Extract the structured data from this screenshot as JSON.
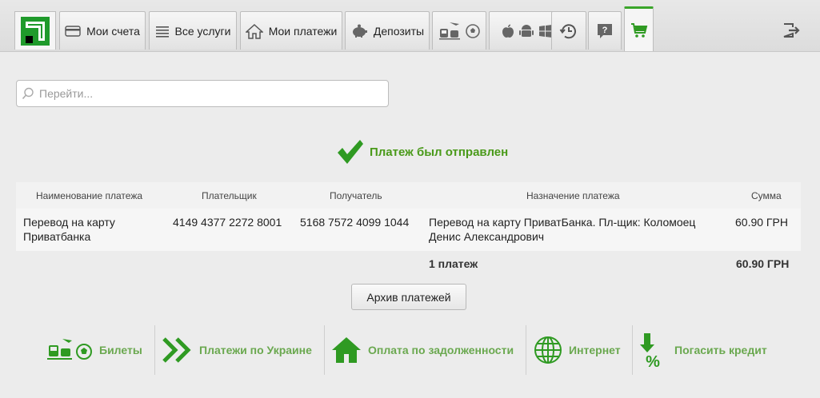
{
  "nav": {
    "tabs": [
      {
        "label": "Мои счета",
        "icon": "card-icon"
      },
      {
        "label": "Все услуги",
        "icon": "list-icon"
      },
      {
        "label": "Мои платежи",
        "icon": "home-icon"
      },
      {
        "label": "Депозиты",
        "icon": "piggy-bank-icon"
      }
    ]
  },
  "search": {
    "placeholder": "Перейти..."
  },
  "status": {
    "message": "Платеж был отправлен"
  },
  "table": {
    "headers": [
      "Наименование платежа",
      "Плательщик",
      "Получатель",
      "Назначение платежа",
      "Сумма"
    ],
    "rows": [
      {
        "name_line1": "Перевод на карту",
        "name_line2": "Приватбанка",
        "payer": "4149 4377 2272 8001",
        "recipient": "5168 7572 4099 1044",
        "purpose_line1": "Перевод на карту ПриватБанка. Пл-щик: Коломоец",
        "purpose_line2": "Денис Александрович",
        "amount": "60.90 ГРН"
      }
    ],
    "total": {
      "count": "1 платеж",
      "amount": "60.90 ГРН"
    }
  },
  "archive_button": "Архив платежей",
  "shortcuts": [
    {
      "label": "Билеты",
      "icon": "tickets-icon"
    },
    {
      "label": "Платежи по Украине",
      "icon": "double-chevron-icon"
    },
    {
      "label": "Оплата по задолженности",
      "icon": "house-icon"
    },
    {
      "label": "Интернет",
      "icon": "globe-icon"
    },
    {
      "label": "Погасить кредит",
      "icon": "percent-arrow-icon"
    }
  ],
  "colors": {
    "brand_green": "#3aa52a",
    "success_green": "#4a9a1a",
    "shortcut_green": "#6aa84f"
  }
}
